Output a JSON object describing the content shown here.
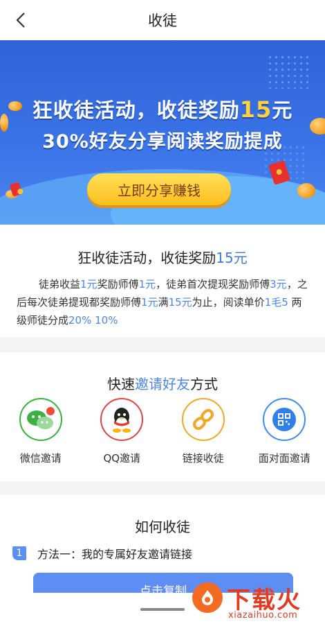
{
  "header": {
    "title": "收徒"
  },
  "banner": {
    "headline_prefix": "狂收徒活动，收徒奖励",
    "headline_amount": "15",
    "headline_suffix": "元",
    "subheadline": "30%好友分享阅读奖励提成",
    "button_label": "立即分享赚钱"
  },
  "activity": {
    "title_prefix": "狂收徒活动，收徒奖励",
    "title_amount": "15元",
    "desc": [
      {
        "t": "徒弟收益",
        "b": false
      },
      {
        "t": "1元",
        "b": true
      },
      {
        "t": "奖励师傅",
        "b": false
      },
      {
        "t": "1元",
        "b": true
      },
      {
        "t": "，徒弟首次提现奖励师傅",
        "b": false
      },
      {
        "t": "3元",
        "b": true
      },
      {
        "t": "，之后每次徒弟提现都奖励师傅",
        "b": false
      },
      {
        "t": "1元",
        "b": true
      },
      {
        "t": "满",
        "b": false
      },
      {
        "t": "15元",
        "b": true
      },
      {
        "t": "为止，阅读单价",
        "b": false
      },
      {
        "t": "1毛5",
        "b": true
      },
      {
        "t": " 两级师徒分成",
        "b": false
      },
      {
        "t": "20% 10%",
        "b": true
      }
    ]
  },
  "invite": {
    "title_prefix": "快速",
    "title_highlight": "邀请好友",
    "title_suffix": "方式",
    "methods": [
      {
        "label": "微信邀请",
        "icon": "wechat-icon",
        "color": "#33b535"
      },
      {
        "label": "QQ邀请",
        "icon": "qq-icon",
        "color": "#e54040"
      },
      {
        "label": "链接收徒",
        "icon": "link-icon",
        "color": "#f5a623"
      },
      {
        "label": "面对面邀请",
        "icon": "qrcode-icon",
        "color": "#3d8cf2"
      }
    ]
  },
  "howto": {
    "title": "如何收徒",
    "step_number": "1",
    "step_text": "方法一：我的专属好友邀请链接",
    "copy_label": "点击复制"
  },
  "watermark": {
    "text": "下载火",
    "sub": "xiazaihuo.com"
  }
}
